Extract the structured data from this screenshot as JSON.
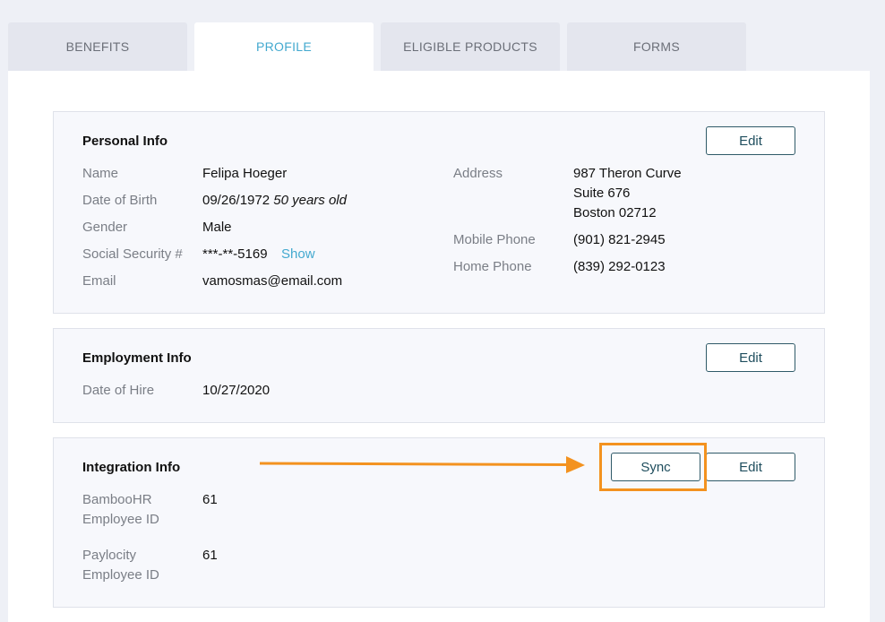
{
  "tabs": [
    {
      "label": "BENEFITS",
      "active": false
    },
    {
      "label": "PROFILE",
      "active": true
    },
    {
      "label": "ELIGIBLE PRODUCTS",
      "active": false
    },
    {
      "label": "FORMS",
      "active": false
    }
  ],
  "personal": {
    "title": "Personal Info",
    "edit_label": "Edit",
    "name_label": "Name",
    "name_value": "Felipa Hoeger",
    "dob_label": "Date of Birth",
    "dob_value": "09/26/1972",
    "age_value": "50 years old",
    "gender_label": "Gender",
    "gender_value": "Male",
    "ssn_label": "Social Security #",
    "ssn_value": "***-**-5169",
    "ssn_show": "Show",
    "email_label": "Email",
    "email_value": "vamosmas@email.com",
    "address_label": "Address",
    "address_line1": "987 Theron Curve",
    "address_line2": "Suite 676",
    "address_line3": "Boston 02712",
    "mobile_label": "Mobile Phone",
    "mobile_value": "(901) 821-2945",
    "home_label": "Home Phone",
    "home_value": "(839) 292-0123"
  },
  "employment": {
    "title": "Employment Info",
    "edit_label": "Edit",
    "hire_label": "Date of Hire",
    "hire_value": "10/27/2020"
  },
  "integration": {
    "title": "Integration Info",
    "sync_label": "Sync",
    "edit_label": "Edit",
    "bamboo_label_1": "BambooHR",
    "bamboo_label_2": "Employee ID",
    "bamboo_value": "61",
    "paylocity_label_1": "Paylocity",
    "paylocity_label_2": "Employee ID",
    "paylocity_value": "61"
  },
  "colors": {
    "accent": "#43a9cf",
    "annotation": "#f3921f",
    "button_border": "#2f5a68"
  }
}
